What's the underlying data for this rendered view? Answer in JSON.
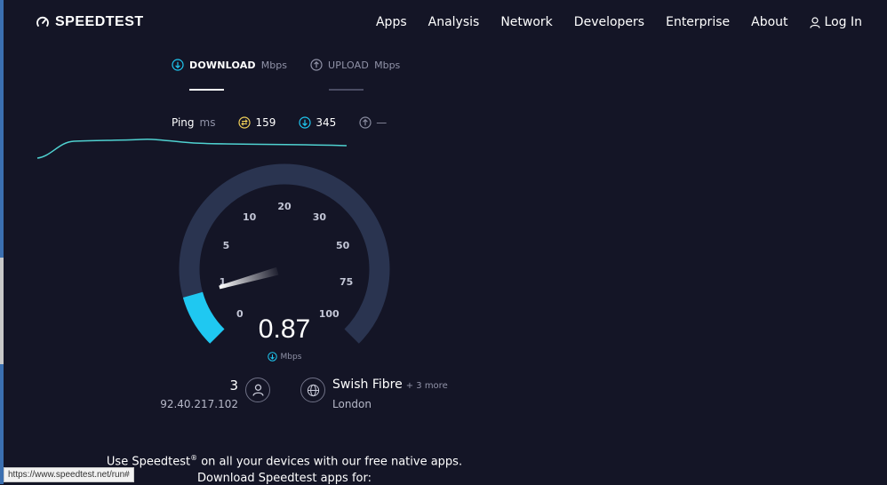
{
  "header": {
    "logo_text": "SPEEDTEST",
    "nav": [
      "Apps",
      "Analysis",
      "Network",
      "Developers",
      "Enterprise",
      "About"
    ],
    "login_label": "Log In"
  },
  "tabs": {
    "download": {
      "label": "DOWNLOAD",
      "unit": "Mbps"
    },
    "upload": {
      "label": "UPLOAD",
      "unit": "Mbps"
    }
  },
  "ping": {
    "label": "Ping",
    "unit": "ms",
    "idle_value": "159",
    "download_value": "345",
    "upload_value": "—"
  },
  "gauge": {
    "ticks": [
      "0",
      "1",
      "5",
      "10",
      "20",
      "30",
      "50",
      "75",
      "100"
    ],
    "current_value": 0.87,
    "max": 100
  },
  "speed": {
    "value": "0.87",
    "unit": "Mbps"
  },
  "connection": {
    "count": "3",
    "ip": "92.40.217.102"
  },
  "server": {
    "isp": "Swish Fibre",
    "more": "+ 3 more",
    "city": "London"
  },
  "promo": {
    "line1_a": "Use Speedtest",
    "line1_reg": "®",
    "line1_b": " on all your devices with our free native apps.",
    "line2": "Download Speedtest apps for:"
  },
  "status_bar": {
    "url": "https://www.speedtest.net/run#"
  },
  "colors": {
    "background": "#141526",
    "accent_cyan": "#1fc8f1",
    "gauge_track": "#2a3450",
    "ping_yellow": "#f2d159"
  }
}
